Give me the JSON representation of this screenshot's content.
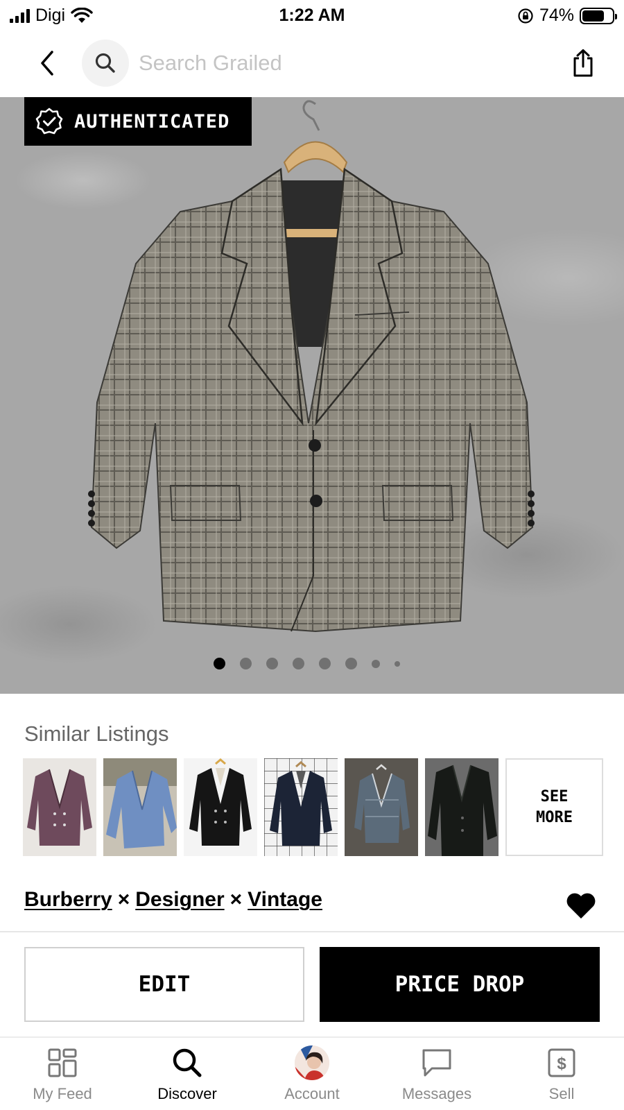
{
  "status_bar": {
    "carrier": "Digi",
    "time": "1:22 AM",
    "battery": "74%",
    "battery_level": 0.74
  },
  "nav": {
    "search_placeholder": "Search Grailed"
  },
  "hero": {
    "badge_label": "AUTHENTICATED",
    "image_count": 8,
    "active_index": 0
  },
  "similar": {
    "title": "Similar Listings",
    "see_more_label": "SEE\nMORE",
    "thumbnails": [
      {
        "desc": "plum plaid double-breasted blazer"
      },
      {
        "desc": "light blue blazer"
      },
      {
        "desc": "black double-breasted blazer"
      },
      {
        "desc": "navy blazer on grid background"
      },
      {
        "desc": "denim blazer"
      },
      {
        "desc": "dark green blazer"
      }
    ]
  },
  "brands": {
    "items": [
      "Burberry",
      "Designer",
      "Vintage"
    ],
    "separator": "×"
  },
  "actions": {
    "edit_label": "EDIT",
    "price_drop_label": "PRICE DROP"
  },
  "tabs": [
    {
      "label": "My Feed",
      "icon": "feed-grid-icon"
    },
    {
      "label": "Discover",
      "icon": "search-icon",
      "active": true
    },
    {
      "label": "Account",
      "icon": "avatar"
    },
    {
      "label": "Messages",
      "icon": "chat-bubble-icon"
    },
    {
      "label": "Sell",
      "icon": "dollar-tag-icon"
    }
  ]
}
